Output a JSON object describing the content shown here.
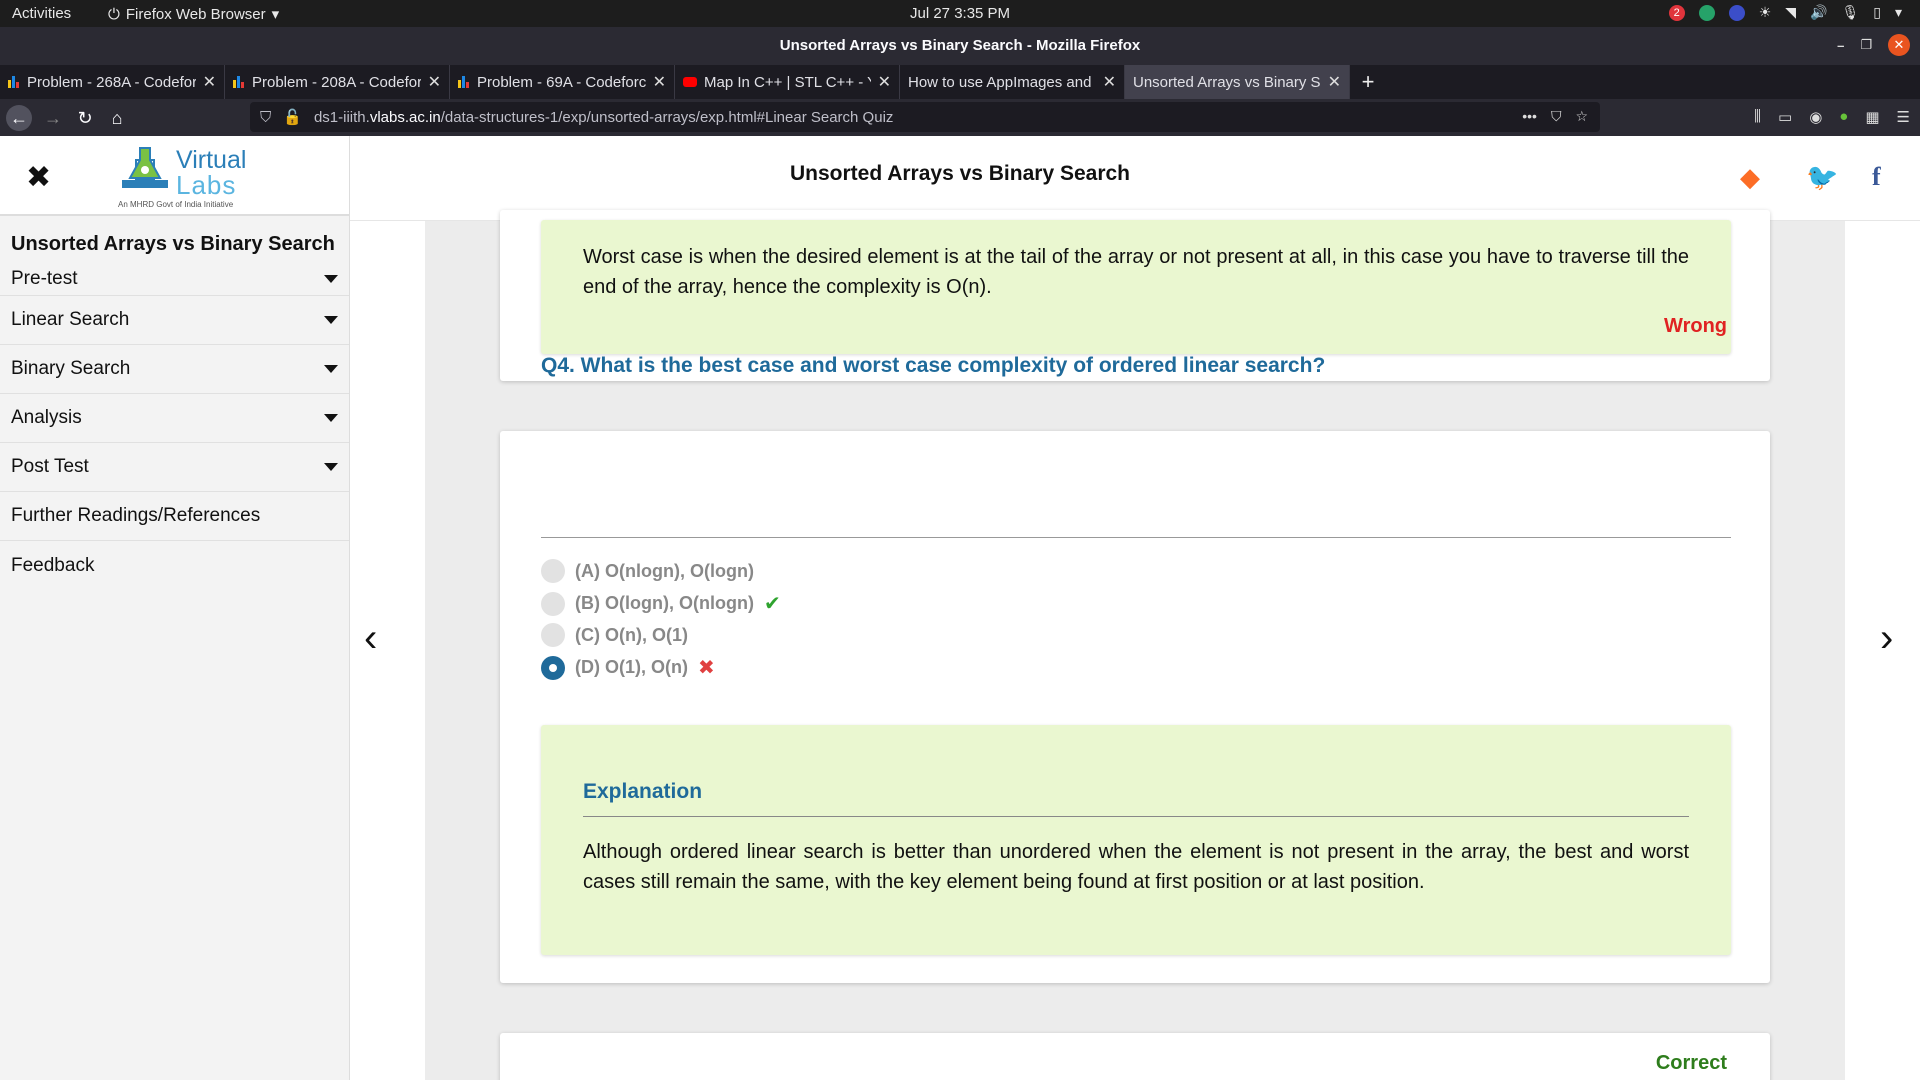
{
  "system_bar": {
    "activities": "Activities",
    "app_name": "Firefox Web Browser",
    "clock": "Jul 27  3:35 PM",
    "notification_count": "2"
  },
  "window": {
    "title": "Unsorted Arrays vs Binary Search - Mozilla Firefox"
  },
  "tabs": [
    {
      "label": "Problem - 268A - Codeforces",
      "favicon": "codeforces-icon"
    },
    {
      "label": "Problem - 208A - Codeforces",
      "favicon": "codeforces-icon"
    },
    {
      "label": "Problem - 69A - Codeforces",
      "favicon": "codeforces-icon"
    },
    {
      "label": "Map In C++ | STL C++ - YouTube",
      "favicon": "youtube-icon"
    },
    {
      "label": "How to use AppImages and",
      "favicon": "none"
    },
    {
      "label": "Unsorted Arrays vs Binary Search",
      "favicon": "none",
      "active": true
    }
  ],
  "url": {
    "prefix": "ds1-iiith.",
    "host": "vlabs.ac.in",
    "path": "/data-structures-1/exp/unsorted-arrays/exp.html#Linear Search Quiz"
  },
  "sidebar": {
    "logo": {
      "line1": "Virtual",
      "line2": "Labs",
      "tagline": "An MHRD Govt of India Initiative"
    },
    "title": "Unsorted Arrays vs Binary Search",
    "items": [
      {
        "label": "Pre-test",
        "has_caret": true
      },
      {
        "label": "Linear Search",
        "has_caret": true
      },
      {
        "label": "Binary Search",
        "has_caret": true
      },
      {
        "label": "Analysis",
        "has_caret": true
      },
      {
        "label": "Post Test",
        "has_caret": true
      },
      {
        "label": "Further Readings/References",
        "has_caret": false
      },
      {
        "label": "Feedback",
        "has_caret": false
      }
    ]
  },
  "header": {
    "title": "Unsorted Arrays vs Binary Search"
  },
  "prev_explanation": {
    "text": "Worst case is when the desired element is at the tail of the array or not present at all, in this case you have to traverse till the end of the array, hence the complexity is O(n)."
  },
  "question": {
    "status": "Wrong",
    "title": "Q4. What is the best case and worst case complexity of ordered linear search?",
    "options": [
      {
        "label": "(A) O(nlogn), O(logn)",
        "selected": false,
        "mark": ""
      },
      {
        "label": "(B) O(logn), O(nlogn)",
        "selected": false,
        "mark": "✔"
      },
      {
        "label": "(C) O(n), O(1)",
        "selected": false,
        "mark": ""
      },
      {
        "label": "(D) O(1), O(n)",
        "selected": true,
        "mark": "✖"
      }
    ],
    "explanation_title": "Explanation",
    "explanation_text": "Although ordered linear search is better than unordered when the element is not present in the array, the best and worst cases still remain the same, with the key element being found at first position or at last position."
  },
  "next_question": {
    "status": "Correct"
  },
  "colors": {
    "accent": "#1f6a9a",
    "wrong": "#e02222",
    "correct": "#2e7d1c",
    "explanation_bg": "#eaf7d0"
  }
}
